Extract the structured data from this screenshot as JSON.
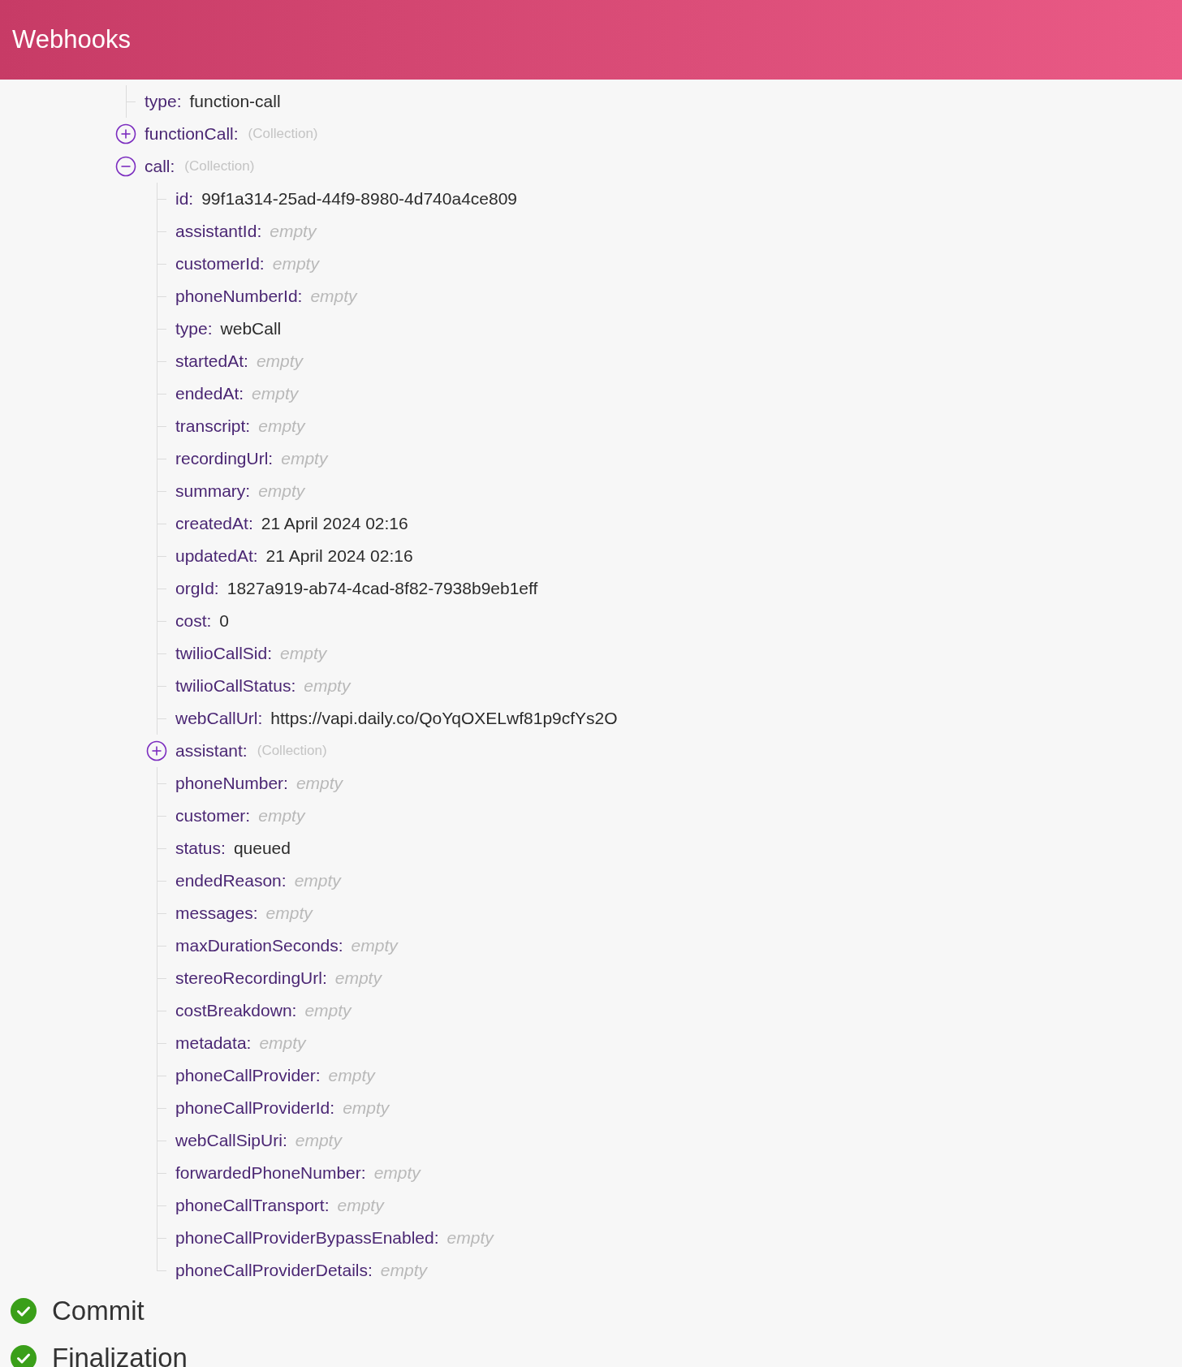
{
  "header": {
    "title": "Webhooks"
  },
  "tree": [
    {
      "key": "type:",
      "kind": "value",
      "value": "function-call"
    },
    {
      "key": "functionCall:",
      "kind": "collection",
      "value": "(Collection)",
      "expanded": false
    },
    {
      "key": "call:",
      "kind": "collection",
      "value": "(Collection)",
      "expanded": true,
      "children": [
        {
          "key": "id:",
          "kind": "value",
          "value": "99f1a314-25ad-44f9-8980-4d740a4ce809"
        },
        {
          "key": "assistantId:",
          "kind": "empty",
          "value": "empty"
        },
        {
          "key": "customerId:",
          "kind": "empty",
          "value": "empty"
        },
        {
          "key": "phoneNumberId:",
          "kind": "empty",
          "value": "empty"
        },
        {
          "key": "type:",
          "kind": "value",
          "value": "webCall"
        },
        {
          "key": "startedAt:",
          "kind": "empty",
          "value": "empty"
        },
        {
          "key": "endedAt:",
          "kind": "empty",
          "value": "empty"
        },
        {
          "key": "transcript:",
          "kind": "empty",
          "value": "empty"
        },
        {
          "key": "recordingUrl:",
          "kind": "empty",
          "value": "empty"
        },
        {
          "key": "summary:",
          "kind": "empty",
          "value": "empty"
        },
        {
          "key": "createdAt:",
          "kind": "value",
          "value": "21 April 2024 02:16"
        },
        {
          "key": "updatedAt:",
          "kind": "value",
          "value": "21 April 2024 02:16"
        },
        {
          "key": "orgId:",
          "kind": "value",
          "value": "1827a919-ab74-4cad-8f82-7938b9eb1eff"
        },
        {
          "key": "cost:",
          "kind": "value",
          "value": "0"
        },
        {
          "key": "twilioCallSid:",
          "kind": "empty",
          "value": "empty"
        },
        {
          "key": "twilioCallStatus:",
          "kind": "empty",
          "value": "empty"
        },
        {
          "key": "webCallUrl:",
          "kind": "value",
          "value": "https://vapi.daily.co/QoYqOXELwf81p9cfYs2O"
        },
        {
          "key": "assistant:",
          "kind": "collection",
          "value": "(Collection)",
          "expanded": false
        },
        {
          "key": "phoneNumber:",
          "kind": "empty",
          "value": "empty"
        },
        {
          "key": "customer:",
          "kind": "empty",
          "value": "empty"
        },
        {
          "key": "status:",
          "kind": "value",
          "value": "queued"
        },
        {
          "key": "endedReason:",
          "kind": "empty",
          "value": "empty"
        },
        {
          "key": "messages:",
          "kind": "empty",
          "value": "empty"
        },
        {
          "key": "maxDurationSeconds:",
          "kind": "empty",
          "value": "empty"
        },
        {
          "key": "stereoRecordingUrl:",
          "kind": "empty",
          "value": "empty"
        },
        {
          "key": "costBreakdown:",
          "kind": "empty",
          "value": "empty"
        },
        {
          "key": "metadata:",
          "kind": "empty",
          "value": "empty"
        },
        {
          "key": "phoneCallProvider:",
          "kind": "empty",
          "value": "empty"
        },
        {
          "key": "phoneCallProviderId:",
          "kind": "empty",
          "value": "empty"
        },
        {
          "key": "webCallSipUri:",
          "kind": "empty",
          "value": "empty"
        },
        {
          "key": "forwardedPhoneNumber:",
          "kind": "empty",
          "value": "empty"
        },
        {
          "key": "phoneCallTransport:",
          "kind": "empty",
          "value": "empty"
        },
        {
          "key": "phoneCallProviderBypassEnabled:",
          "kind": "empty",
          "value": "empty"
        },
        {
          "key": "phoneCallProviderDetails:",
          "kind": "empty",
          "value": "empty"
        }
      ]
    }
  ],
  "steps": [
    {
      "label": "Commit",
      "done": true
    },
    {
      "label": "Finalization",
      "done": true
    }
  ]
}
